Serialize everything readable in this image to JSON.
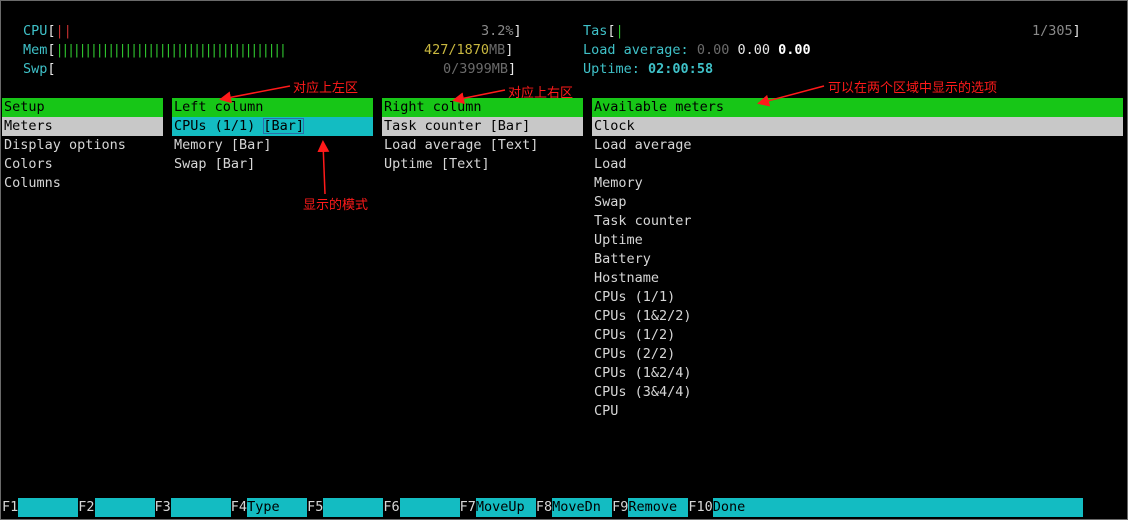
{
  "meters": {
    "cpu": {
      "label": "CPU",
      "bracket_open": "[",
      "bar": "||",
      "value": "3.2%",
      "bracket_close": "]"
    },
    "mem": {
      "label": "Mem",
      "bracket_open": "[",
      "bar": "||||||||||||||||||||||||||||||||||||||||",
      "value": "427/1870",
      "unit": "MB",
      "bracket_close": "]"
    },
    "swp": {
      "label": "Swp",
      "bracket_open": "[",
      "value": "0/3999",
      "unit": "MB",
      "bracket_close": "]"
    },
    "tasks": {
      "label": "Tas",
      "bracket_open": "[",
      "bar": "|",
      "value": "1/305",
      "bracket_close": "]"
    },
    "load": {
      "label": "Load average:",
      "v1": "0.00",
      "v2": "0.00",
      "v3": "0.00"
    },
    "uptime": {
      "label": "Uptime:",
      "value": "02:00:58"
    }
  },
  "setup": {
    "header": "Setup",
    "items": [
      "Meters",
      "Display options",
      "Colors",
      "Columns"
    ]
  },
  "left_column": {
    "header": "Left column",
    "items": [
      {
        "name": "CPUs (1/1) ",
        "mode": "[Bar]"
      },
      {
        "name": "Memory [Bar]"
      },
      {
        "name": "Swap [Bar]"
      }
    ]
  },
  "right_column": {
    "header": "Right column",
    "items": [
      "Task counter [Bar]",
      "Load average [Text]",
      "Uptime [Text]"
    ]
  },
  "available": {
    "header": "Available meters",
    "items": [
      "Clock",
      "Load average",
      "Load",
      "Memory",
      "Swap",
      "Task counter",
      "Uptime",
      "Battery",
      "Hostname",
      "CPUs (1/1)",
      "CPUs (1&2/2)",
      "CPUs (1/2)",
      "CPUs (2/2)",
      "CPUs (1&2/4)",
      "CPUs (3&4/4)",
      "CPU"
    ]
  },
  "function_bar": [
    {
      "key": "F1",
      "label": ""
    },
    {
      "key": "F2",
      "label": ""
    },
    {
      "key": "F3",
      "label": ""
    },
    {
      "key": "F4",
      "label": "Type"
    },
    {
      "key": "F5",
      "label": ""
    },
    {
      "key": "F6",
      "label": ""
    },
    {
      "key": "F7",
      "label": "MoveUp"
    },
    {
      "key": "F8",
      "label": "MoveDn"
    },
    {
      "key": "F9",
      "label": "Remove"
    },
    {
      "key": "F10",
      "label": "Done"
    }
  ],
  "annotations": {
    "left_area": "对应上左区",
    "right_area": "对应上右区",
    "available": "可以在两个区域中显示的选项",
    "mode": "显示的模式"
  },
  "colors": {
    "header_bg": "#17c617",
    "selected_bg": "#c8c8c8",
    "cyan": "#13bcc2",
    "annotation": "#ff1a1a"
  }
}
